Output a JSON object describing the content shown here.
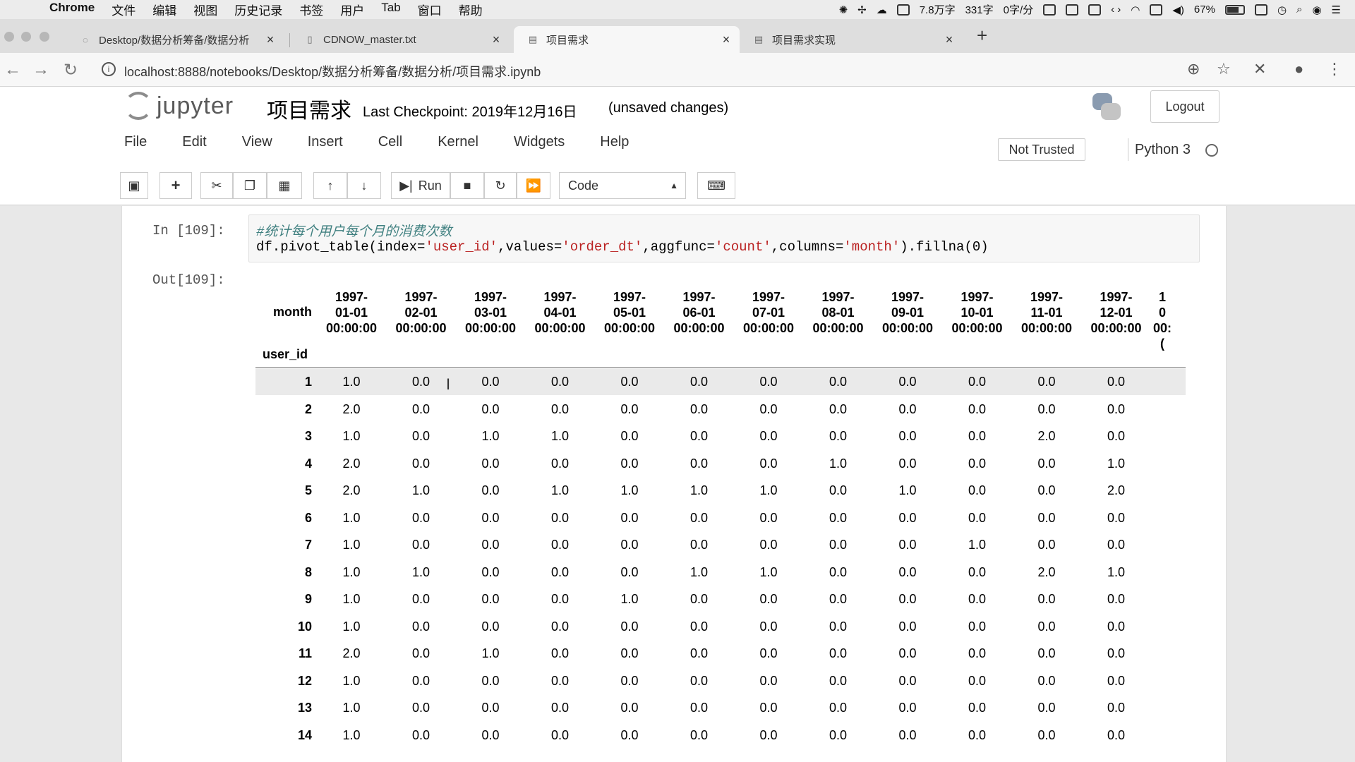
{
  "mac_menubar": {
    "app": "Chrome",
    "items": [
      "文件",
      "编辑",
      "视图",
      "历史记录",
      "书签",
      "用户",
      "Tab",
      "窗口",
      "帮助"
    ],
    "status": {
      "word_count": "7.8万字",
      "chars": "331字",
      "rate": "0字/分",
      "battery": "67%"
    }
  },
  "tabs": [
    {
      "title": "Desktop/数据分析筹备/数据分析",
      "icon": "loading-icon",
      "active": false
    },
    {
      "title": "CDNOW_master.txt",
      "icon": "file-icon",
      "active": false
    },
    {
      "title": "项目需求",
      "icon": "notebook-icon",
      "active": true
    },
    {
      "title": "项目需求实现",
      "icon": "notebook-icon",
      "active": false
    }
  ],
  "address_bar": {
    "url": "localhost:8888/notebooks/Desktop/数据分析筹备/数据分析/项目需求.ipynb"
  },
  "jupyter": {
    "logo_text": "jupyter",
    "notebook_name": "项目需求",
    "checkpoint": "Last Checkpoint: 2019年12月16日",
    "unsaved": "(unsaved changes)",
    "logout": "Logout",
    "menu": [
      "File",
      "Edit",
      "View",
      "Insert",
      "Cell",
      "Kernel",
      "Widgets",
      "Help"
    ],
    "not_trusted": "Not Trusted",
    "kernel": "Python 3",
    "toolbar": {
      "run_label": "Run",
      "cell_type": "Code"
    }
  },
  "cell": {
    "in_prompt": "In [109]:",
    "out_prompt": "Out[109]:",
    "comment": "#统计每个用户每个月的消费次数",
    "code_prefix": "df.pivot_table(index=",
    "code_s1": "'user_id'",
    "code_m1": ",values=",
    "code_s2": "'order_dt'",
    "code_m2": ",aggfunc=",
    "code_s3": "'count'",
    "code_m3": ",columns=",
    "code_s4": "'month'",
    "code_suffix": ").fillna(0)"
  },
  "output_table": {
    "columns_label": "month",
    "index_label": "user_id",
    "columns": [
      [
        "1997-",
        "01-01",
        "00:00:00"
      ],
      [
        "1997-",
        "02-01",
        "00:00:00"
      ],
      [
        "1997-",
        "03-01",
        "00:00:00"
      ],
      [
        "1997-",
        "04-01",
        "00:00:00"
      ],
      [
        "1997-",
        "05-01",
        "00:00:00"
      ],
      [
        "1997-",
        "06-01",
        "00:00:00"
      ],
      [
        "1997-",
        "07-01",
        "00:00:00"
      ],
      [
        "1997-",
        "08-01",
        "00:00:00"
      ],
      [
        "1997-",
        "09-01",
        "00:00:00"
      ],
      [
        "1997-",
        "10-01",
        "00:00:00"
      ],
      [
        "1997-",
        "11-01",
        "00:00:00"
      ],
      [
        "1997-",
        "12-01",
        "00:00:00"
      ],
      [
        "1",
        "0",
        "00:("
      ]
    ],
    "rows": [
      {
        "id": "1",
        "values": [
          "1.0",
          "0.0",
          "0.0",
          "0.0",
          "0.0",
          "0.0",
          "0.0",
          "0.0",
          "0.0",
          "0.0",
          "0.0",
          "0.0"
        ]
      },
      {
        "id": "2",
        "values": [
          "2.0",
          "0.0",
          "0.0",
          "0.0",
          "0.0",
          "0.0",
          "0.0",
          "0.0",
          "0.0",
          "0.0",
          "0.0",
          "0.0"
        ]
      },
      {
        "id": "3",
        "values": [
          "1.0",
          "0.0",
          "1.0",
          "1.0",
          "0.0",
          "0.0",
          "0.0",
          "0.0",
          "0.0",
          "0.0",
          "2.0",
          "0.0"
        ]
      },
      {
        "id": "4",
        "values": [
          "2.0",
          "0.0",
          "0.0",
          "0.0",
          "0.0",
          "0.0",
          "0.0",
          "1.0",
          "0.0",
          "0.0",
          "0.0",
          "1.0"
        ]
      },
      {
        "id": "5",
        "values": [
          "2.0",
          "1.0",
          "0.0",
          "1.0",
          "1.0",
          "1.0",
          "1.0",
          "0.0",
          "1.0",
          "0.0",
          "0.0",
          "2.0"
        ]
      },
      {
        "id": "6",
        "values": [
          "1.0",
          "0.0",
          "0.0",
          "0.0",
          "0.0",
          "0.0",
          "0.0",
          "0.0",
          "0.0",
          "0.0",
          "0.0",
          "0.0"
        ]
      },
      {
        "id": "7",
        "values": [
          "1.0",
          "0.0",
          "0.0",
          "0.0",
          "0.0",
          "0.0",
          "0.0",
          "0.0",
          "0.0",
          "1.0",
          "0.0",
          "0.0"
        ]
      },
      {
        "id": "8",
        "values": [
          "1.0",
          "1.0",
          "0.0",
          "0.0",
          "0.0",
          "1.0",
          "1.0",
          "0.0",
          "0.0",
          "0.0",
          "2.0",
          "1.0"
        ]
      },
      {
        "id": "9",
        "values": [
          "1.0",
          "0.0",
          "0.0",
          "0.0",
          "1.0",
          "0.0",
          "0.0",
          "0.0",
          "0.0",
          "0.0",
          "0.0",
          "0.0"
        ]
      },
      {
        "id": "10",
        "values": [
          "1.0",
          "0.0",
          "0.0",
          "0.0",
          "0.0",
          "0.0",
          "0.0",
          "0.0",
          "0.0",
          "0.0",
          "0.0",
          "0.0"
        ]
      },
      {
        "id": "11",
        "values": [
          "2.0",
          "0.0",
          "1.0",
          "0.0",
          "0.0",
          "0.0",
          "0.0",
          "0.0",
          "0.0",
          "0.0",
          "0.0",
          "0.0"
        ]
      },
      {
        "id": "12",
        "values": [
          "1.0",
          "0.0",
          "0.0",
          "0.0",
          "0.0",
          "0.0",
          "0.0",
          "0.0",
          "0.0",
          "0.0",
          "0.0",
          "0.0"
        ]
      },
      {
        "id": "13",
        "values": [
          "1.0",
          "0.0",
          "0.0",
          "0.0",
          "0.0",
          "0.0",
          "0.0",
          "0.0",
          "0.0",
          "0.0",
          "0.0",
          "0.0"
        ]
      },
      {
        "id": "14",
        "values": [
          "1.0",
          "0.0",
          "0.0",
          "0.0",
          "0.0",
          "0.0",
          "0.0",
          "0.0",
          "0.0",
          "0.0",
          "0.0",
          "0.0"
        ]
      }
    ]
  }
}
